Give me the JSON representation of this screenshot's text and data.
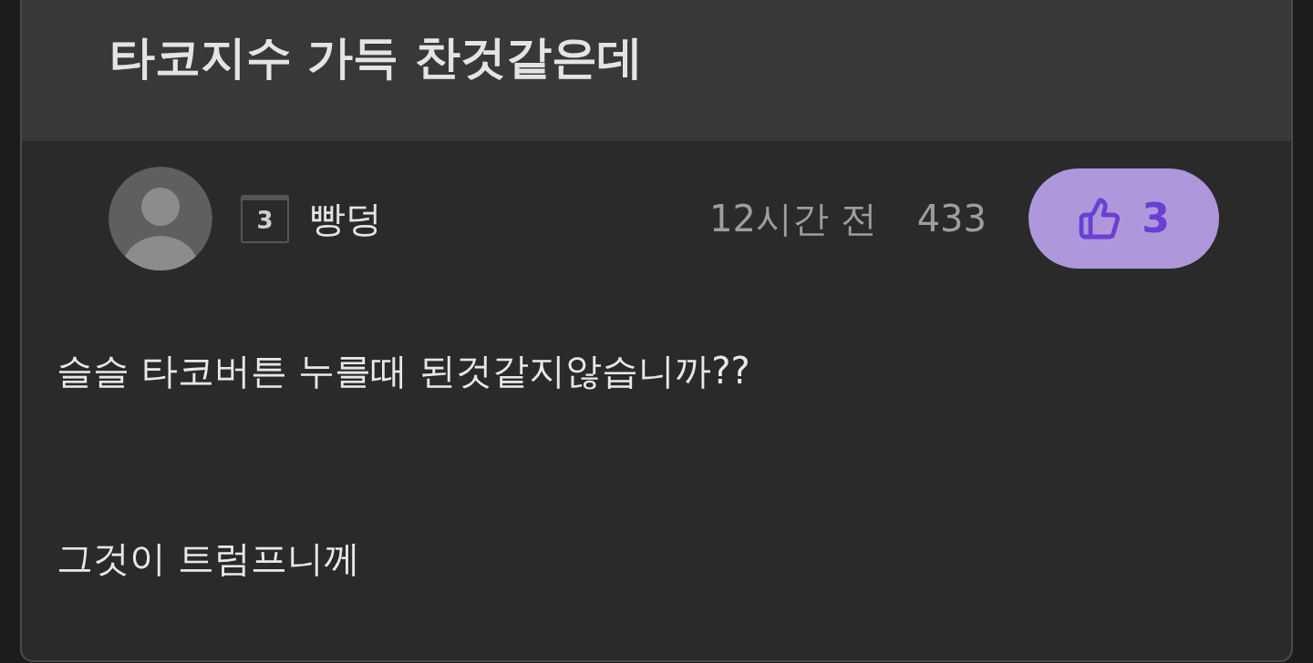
{
  "post": {
    "title": "타코지수 가득 찬것같은데",
    "author": {
      "name": "빵덩",
      "level": "3"
    },
    "time": "12시간 전",
    "views": "433",
    "like": {
      "count": "3",
      "selected": true
    },
    "body": [
      "슬슬 타코버튼 누를때 된것같지않습니까??",
      "그것이 트럼프니께"
    ]
  }
}
